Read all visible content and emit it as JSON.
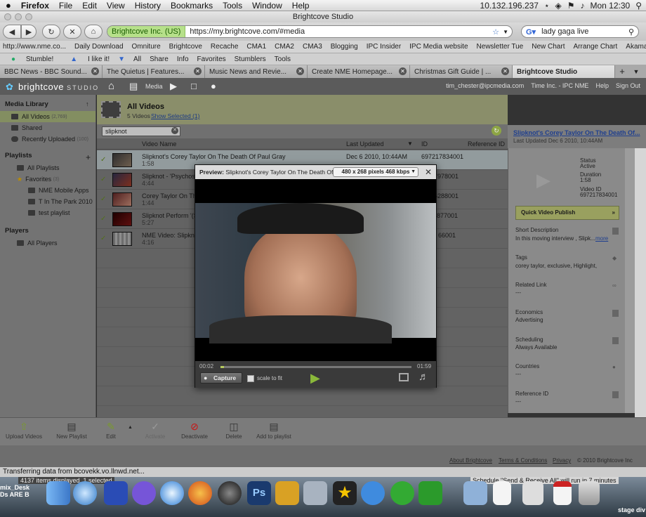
{
  "menubar": {
    "apple": "",
    "app": "Firefox",
    "items": [
      "File",
      "Edit",
      "View",
      "History",
      "Bookmarks",
      "Tools",
      "Window",
      "Help"
    ],
    "ip": "10.132.196.237",
    "clock": "Mon 12:30"
  },
  "window": {
    "title": "Brightcove Studio"
  },
  "navbar": {
    "site_identity": "Brightcove Inc. (US)",
    "url": "https://my.brightcove.com/#media",
    "search_value": "lady gaga live"
  },
  "bookmarks": [
    "http://www.nme.co...",
    "Daily Download",
    "Omniture",
    "Brightcove",
    "Recache",
    "CMA1",
    "CMA2",
    "CMA3",
    "Blogging",
    "IPC Insider",
    "IPC Media website",
    "Newsletter Tue",
    "New Chart",
    "Arrange Chart",
    "Akamai EdgeControl"
  ],
  "toolbar2": [
    "Stumble!",
    "I like it!",
    "All",
    "Share",
    "Info",
    "Favorites",
    "Stumblers",
    "Tools"
  ],
  "tabs": [
    {
      "label": "BBC News - BBC Sound...",
      "active": false
    },
    {
      "label": "The Quietus | Features...",
      "active": false
    },
    {
      "label": "Music News and Revie...",
      "active": false
    },
    {
      "label": "Create NME Homepage...",
      "active": false
    },
    {
      "label": "Christmas Gift Guide | ...",
      "active": false
    },
    {
      "label": "Brightcove Studio",
      "active": true
    }
  ],
  "header": {
    "logo": "brightcove",
    "logo_suffix": "STUDIO",
    "media_label": "Media",
    "user": "tim_chester@ipcmedia.com",
    "account": "Time Inc. - IPC NME",
    "help": "Help",
    "signout": "Sign Out"
  },
  "sidebar": {
    "library_heading": "Media Library",
    "library_items": [
      {
        "label": "All Videos",
        "count": "(2,769)"
      },
      {
        "label": "Shared",
        "count": ""
      },
      {
        "label": "Recently Uploaded",
        "count": "(100)"
      }
    ],
    "playlists_heading": "Playlists",
    "all_playlists": "All Playlists",
    "favorites": "Favorites",
    "favorites_count": "(3)",
    "playlist_items": [
      "NME Mobile Apps",
      "T In The Park 2010",
      "test playlist"
    ],
    "players_heading": "Players",
    "all_players": "All Players"
  },
  "main": {
    "title": "All Videos",
    "subtitle": "5 Videos",
    "show_selected": "Show Selected (1)",
    "filter": "slipknot",
    "columns": [
      "Video Name",
      "Last Updated",
      "ID",
      "Reference ID"
    ],
    "rows": [
      {
        "name": "Slipknot's Corey Taylor On The Death Of Paul Gray",
        "duration": "1:58",
        "updated": "Dec 6 2010, 10:44AM",
        "id": "697217834001"
      },
      {
        "name": "Slipknot - 'Psychosoc",
        "duration": "4:44",
        "updated": "",
        "id": "7978001"
      },
      {
        "name": "Corey Taylor On The",
        "duration": "1:44",
        "updated": "",
        "id": "6288001"
      },
      {
        "name": "Slipknot Perform '(Sic",
        "duration": "5:27",
        "updated": "",
        "id": "877001"
      },
      {
        "name": "NME Video: Slipknot",
        "duration": "4:16",
        "updated": "",
        "id": "66001"
      }
    ]
  },
  "details": {
    "title": "Slipknot's Corey Taylor On The Death Of...",
    "last_updated": "Last Updated Dec 6 2010, 10:44AM",
    "status_label": "Status",
    "status": "Active",
    "duration_label": "Duration",
    "duration": "1:58",
    "video_id_label": "Video ID",
    "video_id": "697217834001",
    "quick_publish": "Quick Video Publish",
    "short_desc_label": "Short Description",
    "short_desc": "In this moving interview , Slipk...",
    "more": "more",
    "tags_label": "Tags",
    "tags": "corey taylor, exclusive, Highlight,",
    "related_label": "Related Link",
    "related": "---",
    "economics_label": "Economics",
    "economics": "Advertising",
    "scheduling_label": "Scheduling",
    "scheduling": "Always Available",
    "countries_label": "Countries",
    "countries": "---",
    "refid_label": "Reference ID",
    "refid": "---"
  },
  "bottom": {
    "upload": "Upload Videos",
    "new_playlist": "New Playlist",
    "edit": "Edit",
    "activate": "Activate",
    "deactivate": "Deactivate",
    "delete": "Delete",
    "add_to_playlist": "Add to playlist"
  },
  "footer": {
    "about": "About Brightcove",
    "terms": "Terms & Conditions",
    "privacy": "Privacy",
    "copyright": "© 2010 Brightcove Inc"
  },
  "statusbar": {
    "text": "Transferring data from bcovekk.vo.llnwd.net...",
    "items": "4137 items displayed, 1 selected",
    "schedule": "Schedule \"Send & Receive All\" will run in 7 minutes"
  },
  "modal": {
    "preview_label": "Preview:",
    "preview_title": "Slipknot's Corey Taylor On The Death Of...",
    "size_option": "480 x 268 pixels 468 kbps",
    "elapsed": "00:02",
    "total": "01:59",
    "progress": 0.02,
    "capture": "Capture",
    "scale": "scale to fit"
  },
  "dock_labels": {
    "left": "mix_Desk",
    "left2": "Ds ARE B",
    "right": "stage div"
  },
  "colors": {
    "accent_green": "#9ab44a",
    "selected_row": "#9fa9ab",
    "link_blue": "#1f3f8f"
  }
}
